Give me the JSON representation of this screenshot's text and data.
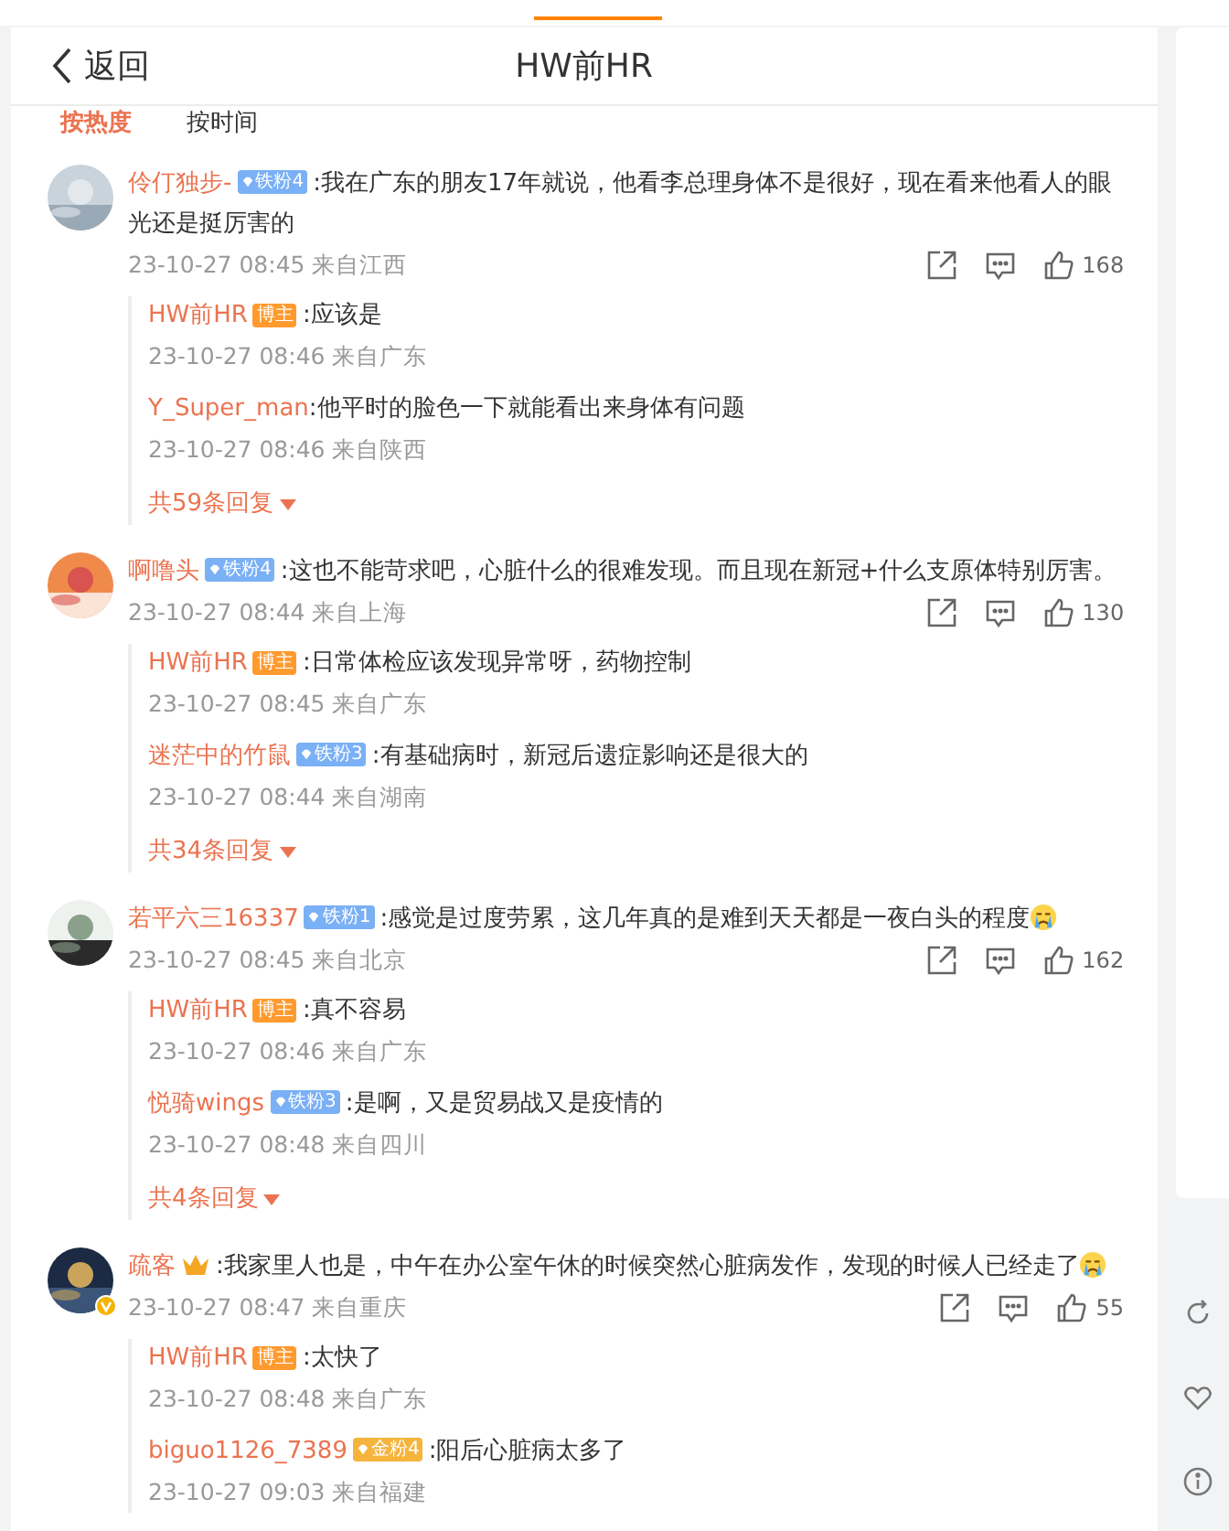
{
  "header": {
    "back_label": "返回",
    "title": "HW前HR"
  },
  "sort_tabs": [
    {
      "label": "按热度",
      "selected": true
    },
    {
      "label": "按时间",
      "selected": false
    }
  ],
  "comments": [
    {
      "user": "伶仃独步-",
      "badge": {
        "kind": "fan",
        "label": "铁粉4"
      },
      "text": ":我在广东的朋友17年就说，他看李总理身体不是很好，现在看来他看人的眼光还是挺厉害的",
      "meta": "23-10-27 08:45 来自江西",
      "likes": "168",
      "verified": false,
      "replies": [
        {
          "user": "HW前HR",
          "badge": {
            "kind": "author",
            "label": "博主"
          },
          "text": ":应该是",
          "meta": "23-10-27 08:46 来自广东"
        },
        {
          "user": "Y_Super_man",
          "text": ":他平时的脸色一下就能看出来身体有问题",
          "meta": "23-10-27 08:46 来自陕西"
        }
      ],
      "more": "共59条回复"
    },
    {
      "user": "啊噜头",
      "badge": {
        "kind": "fan",
        "label": "铁粉4"
      },
      "text": ":这也不能苛求吧，心脏什么的很难发现。而且现在新冠+什么支原体特别厉害。",
      "meta": "23-10-27 08:44 来自上海",
      "likes": "130",
      "verified": false,
      "replies": [
        {
          "user": "HW前HR",
          "badge": {
            "kind": "author",
            "label": "博主"
          },
          "text": ":日常体检应该发现异常呀，药物控制",
          "meta": "23-10-27 08:45 来自广东"
        },
        {
          "user": "迷茫中的竹鼠",
          "badge": {
            "kind": "fan",
            "label": "铁粉3"
          },
          "text": ":有基础病时，新冠后遗症影响还是很大的",
          "meta": "23-10-27 08:44 来自湖南"
        }
      ],
      "more": "共34条回复"
    },
    {
      "user": "若平六三16337",
      "badge": {
        "kind": "fan",
        "label": "铁粉1"
      },
      "text": ":感觉是过度劳累，这几年真的是难到天天都是一夜白头的程度",
      "crying_emoji": true,
      "meta": "23-10-27 08:45 来自北京",
      "likes": "162",
      "verified": false,
      "replies": [
        {
          "user": "HW前HR",
          "badge": {
            "kind": "author",
            "label": "博主"
          },
          "text": ":真不容易",
          "meta": "23-10-27 08:46 来自广东"
        },
        {
          "user": "悦骑wings",
          "badge": {
            "kind": "fan",
            "label": "铁粉3"
          },
          "text": ":是啊，又是贸易战又是疫情的",
          "meta": "23-10-27 08:48 来自四川"
        }
      ],
      "more": "共4条回复"
    },
    {
      "user": "疏客",
      "badge": {
        "kind": "crown"
      },
      "text": ":我家里人也是，中午在办公室午休的时候突然心脏病发作，发现的时候人已经走了",
      "crying_emoji": true,
      "meta": "23-10-27 08:47 来自重庆",
      "likes": "55",
      "verified": true,
      "replies": [
        {
          "user": "HW前HR",
          "badge": {
            "kind": "author",
            "label": "博主"
          },
          "text": ":太快了",
          "meta": "23-10-27 08:48 来自广东"
        },
        {
          "user": "biguo1126_7389",
          "badge": {
            "kind": "gold",
            "label": "金粉4"
          },
          "text": ":阳后心脏病太多了",
          "meta": "23-10-27 09:03 来自福建"
        }
      ]
    }
  ]
}
